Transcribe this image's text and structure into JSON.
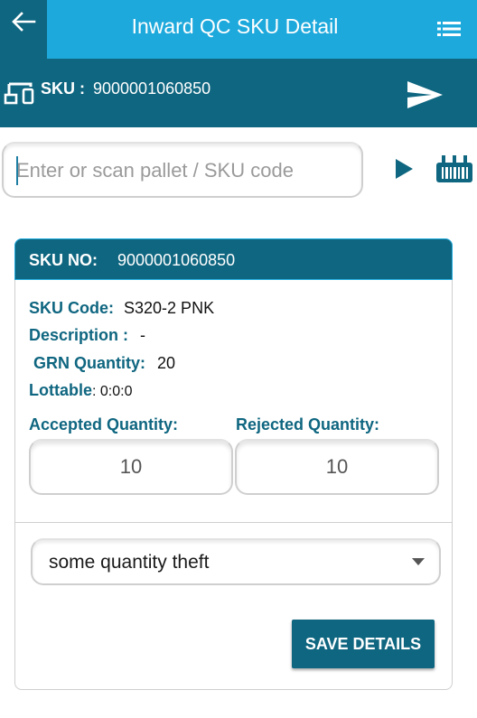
{
  "appbar": {
    "title": "Inward QC SKU Detail",
    "back_icon": "arrow-left-icon",
    "menu_icon": "list-menu-icon",
    "colors": {
      "back_bg": "#0f6680",
      "title_bg": "#1ea9dc"
    }
  },
  "sku_header": {
    "label": "SKU :",
    "value": "9000001060850",
    "device_icon": "devices-icon",
    "send_icon": "send-icon"
  },
  "scan": {
    "placeholder": "Enter or scan pallet / SKU code",
    "value": "",
    "play_icon": "play-icon",
    "barcode_icon": "barcode-scanner-icon"
  },
  "card": {
    "header_label": "SKU NO:",
    "header_value": "9000001060850",
    "fields": {
      "sku_code_label": "SKU Code:",
      "sku_code_value": "S320-2 PNK",
      "description_label": "Description :",
      "description_value": "-",
      "grn_label": "GRN Quantity:",
      "grn_value": "20",
      "lottable_label": "Lottable",
      "lottable_value": ": 0:0:0"
    },
    "accepted_label": "Accepted Quantity:",
    "accepted_value": "10",
    "rejected_label": "Rejected Quantity:",
    "rejected_value": "10",
    "reason_selected": "some quantity theft",
    "save_label": "SAVE DETAILS"
  }
}
